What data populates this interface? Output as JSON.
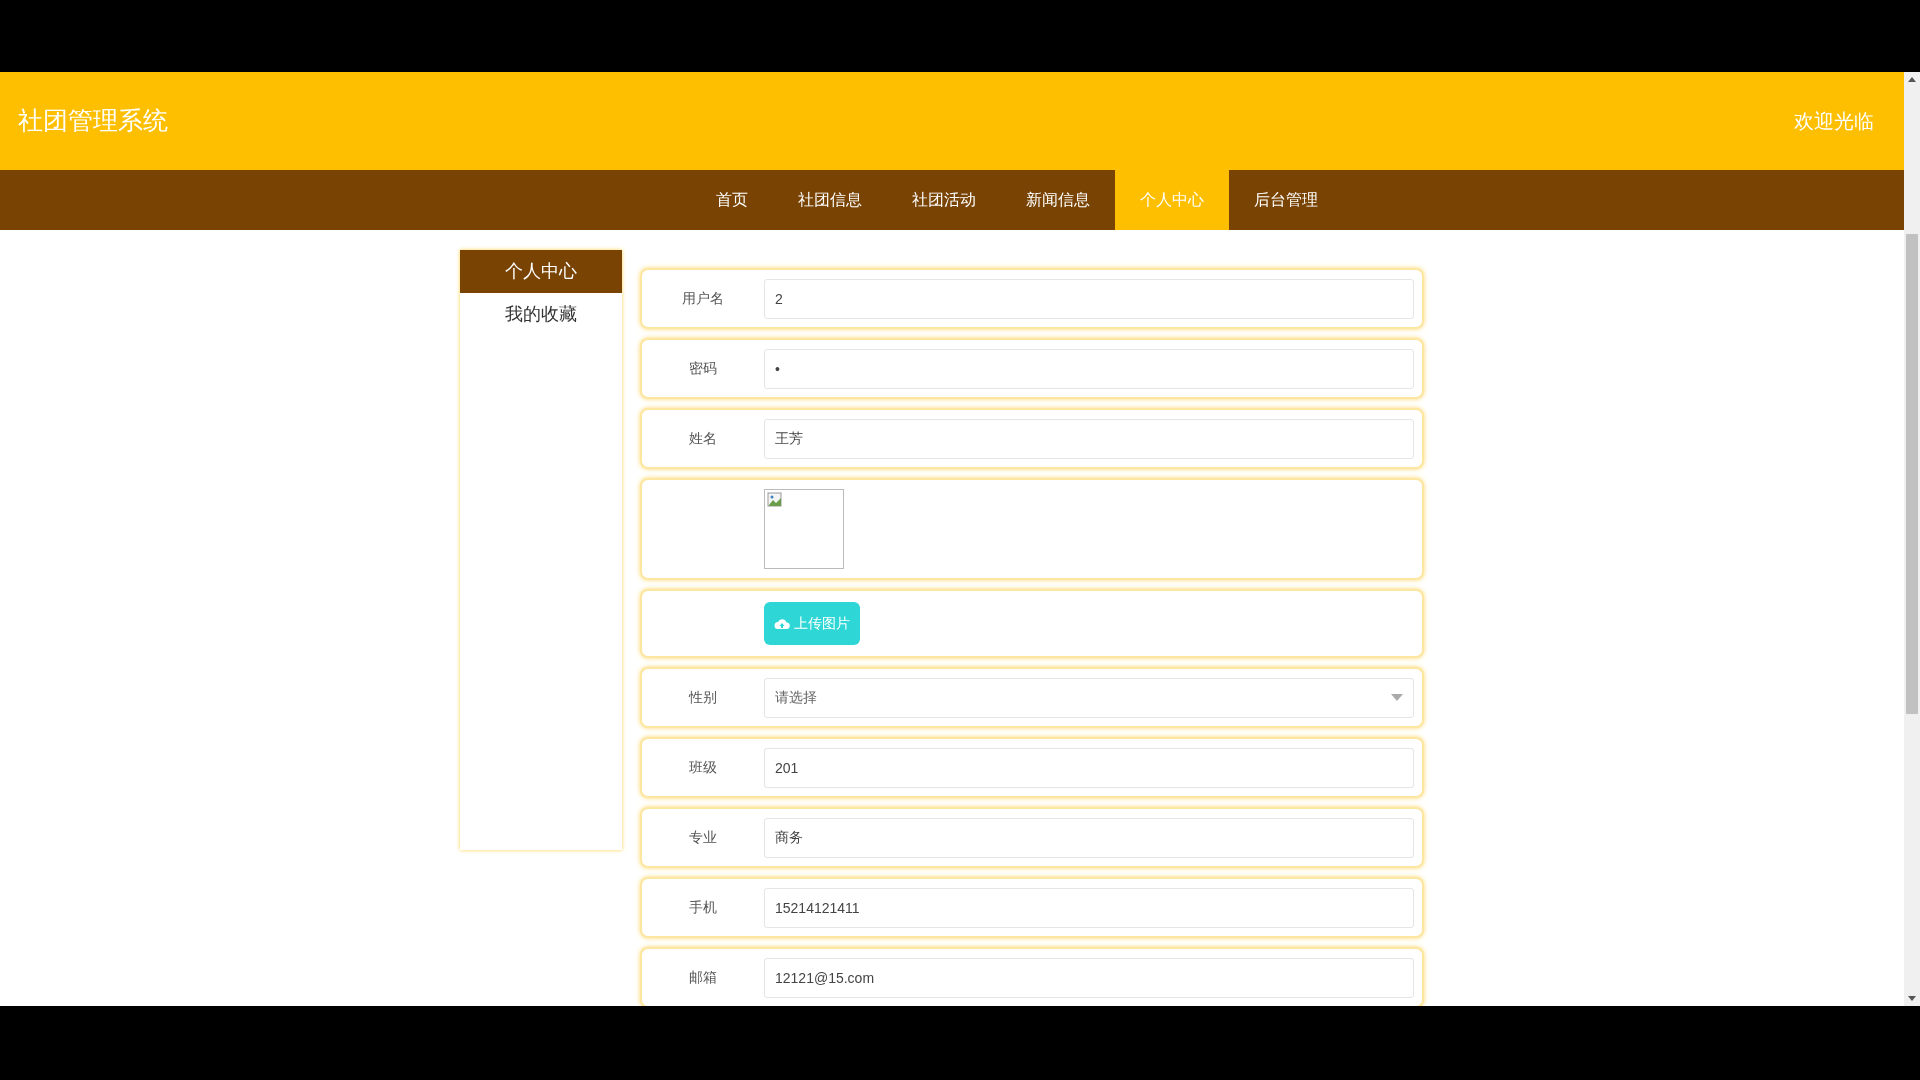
{
  "header": {
    "title": "社团管理系统",
    "welcome": "欢迎光临"
  },
  "nav": [
    {
      "label": "首页",
      "selected": false
    },
    {
      "label": "社团信息",
      "selected": false
    },
    {
      "label": "社团活动",
      "selected": false
    },
    {
      "label": "新闻信息",
      "selected": false
    },
    {
      "label": "个人中心",
      "selected": true
    },
    {
      "label": "后台管理",
      "selected": false
    }
  ],
  "sidebar": {
    "items": [
      {
        "label": "个人中心",
        "selected": true
      },
      {
        "label": "我的收藏",
        "selected": false
      }
    ]
  },
  "form": {
    "rows": [
      {
        "kind": "text",
        "label": "用户名",
        "value": "2"
      },
      {
        "kind": "text",
        "label": "密码",
        "value": "•"
      },
      {
        "kind": "text",
        "label": "姓名",
        "value": "王芳"
      },
      {
        "kind": "image"
      },
      {
        "kind": "upload",
        "button": "上传图片"
      },
      {
        "kind": "select",
        "label": "性别",
        "placeholder": "请选择"
      },
      {
        "kind": "text",
        "label": "班级",
        "value": "201"
      },
      {
        "kind": "text",
        "label": "专业",
        "value": "商务"
      },
      {
        "kind": "text",
        "label": "手机",
        "value": "15214121411"
      },
      {
        "kind": "text",
        "label": "邮箱",
        "value": "12121@15.com"
      }
    ]
  }
}
